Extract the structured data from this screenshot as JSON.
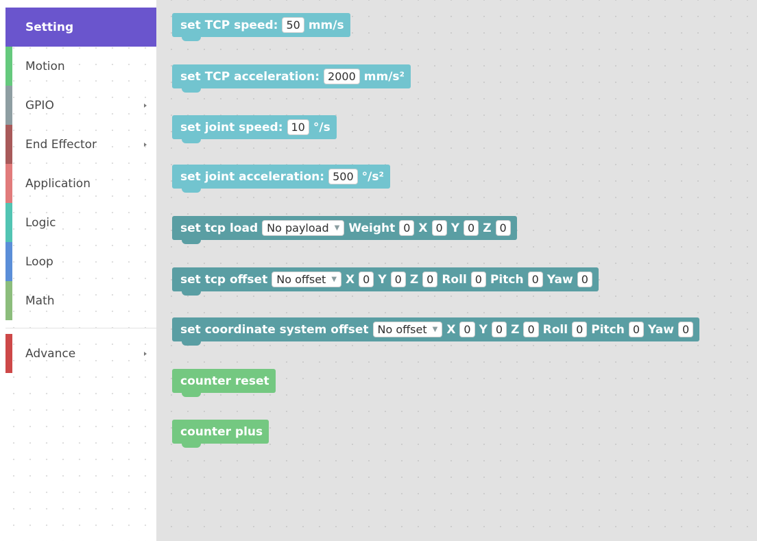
{
  "categories": [
    {
      "label": "Setting",
      "color": "#6a55cd",
      "selected": true
    },
    {
      "label": "Motion",
      "color": "#65c97d"
    },
    {
      "label": "GPIO",
      "color": "#8e9ea2",
      "submenu": true
    },
    {
      "label": "End Effector",
      "color": "#a85a5a",
      "submenu": true
    },
    {
      "label": "Application",
      "color": "#e17b7b"
    },
    {
      "label": "Logic",
      "color": "#52c4b3"
    },
    {
      "label": "Loop",
      "color": "#5b8ed8"
    },
    {
      "label": "Math",
      "color": "#8cbd7c"
    },
    {
      "label": "Advance",
      "color": "#cd4848",
      "submenu": true
    }
  ],
  "blocks": {
    "tcp_speed": {
      "label": "set TCP speed:",
      "value": "50",
      "unit": "mm/s"
    },
    "tcp_accel": {
      "label": "set TCP acceleration:",
      "value": "2000",
      "unit": "mm/s²"
    },
    "joint_speed": {
      "label": "set joint speed:",
      "value": "10",
      "unit": "°/s"
    },
    "joint_accel": {
      "label": "set joint acceleration:",
      "value": "500",
      "unit": "°/s²"
    },
    "tcp_load": {
      "label": "set tcp load",
      "dropdown": "No payload",
      "weight_label": "Weight",
      "weight": "0",
      "x_label": "X",
      "x": "0",
      "y_label": "Y",
      "y": "0",
      "z_label": "Z",
      "z": "0"
    },
    "tcp_offset": {
      "label": "set tcp offset",
      "dropdown": "No offset",
      "x_label": "X",
      "x": "0",
      "y_label": "Y",
      "y": "0",
      "z_label": "Z",
      "z": "0",
      "roll_label": "Roll",
      "roll": "0",
      "pitch_label": "Pitch",
      "pitch": "0",
      "yaw_label": "Yaw",
      "yaw": "0"
    },
    "coord_offset": {
      "label": "set coordinate system offset",
      "dropdown": "No offset",
      "x_label": "X",
      "x": "0",
      "y_label": "Y",
      "y": "0",
      "z_label": "Z",
      "z": "0",
      "roll_label": "Roll",
      "roll": "0",
      "pitch_label": "Pitch",
      "pitch": "0",
      "yaw_label": "Yaw",
      "yaw": "0"
    },
    "counter_reset": {
      "label": "counter reset"
    },
    "counter_plus": {
      "label": "counter plus"
    }
  },
  "colors": {
    "set_block": "#72c4cf",
    "dark_block": "#5a9ea3",
    "counter_block": "#74c881",
    "workspace": "#e2e2e2"
  }
}
